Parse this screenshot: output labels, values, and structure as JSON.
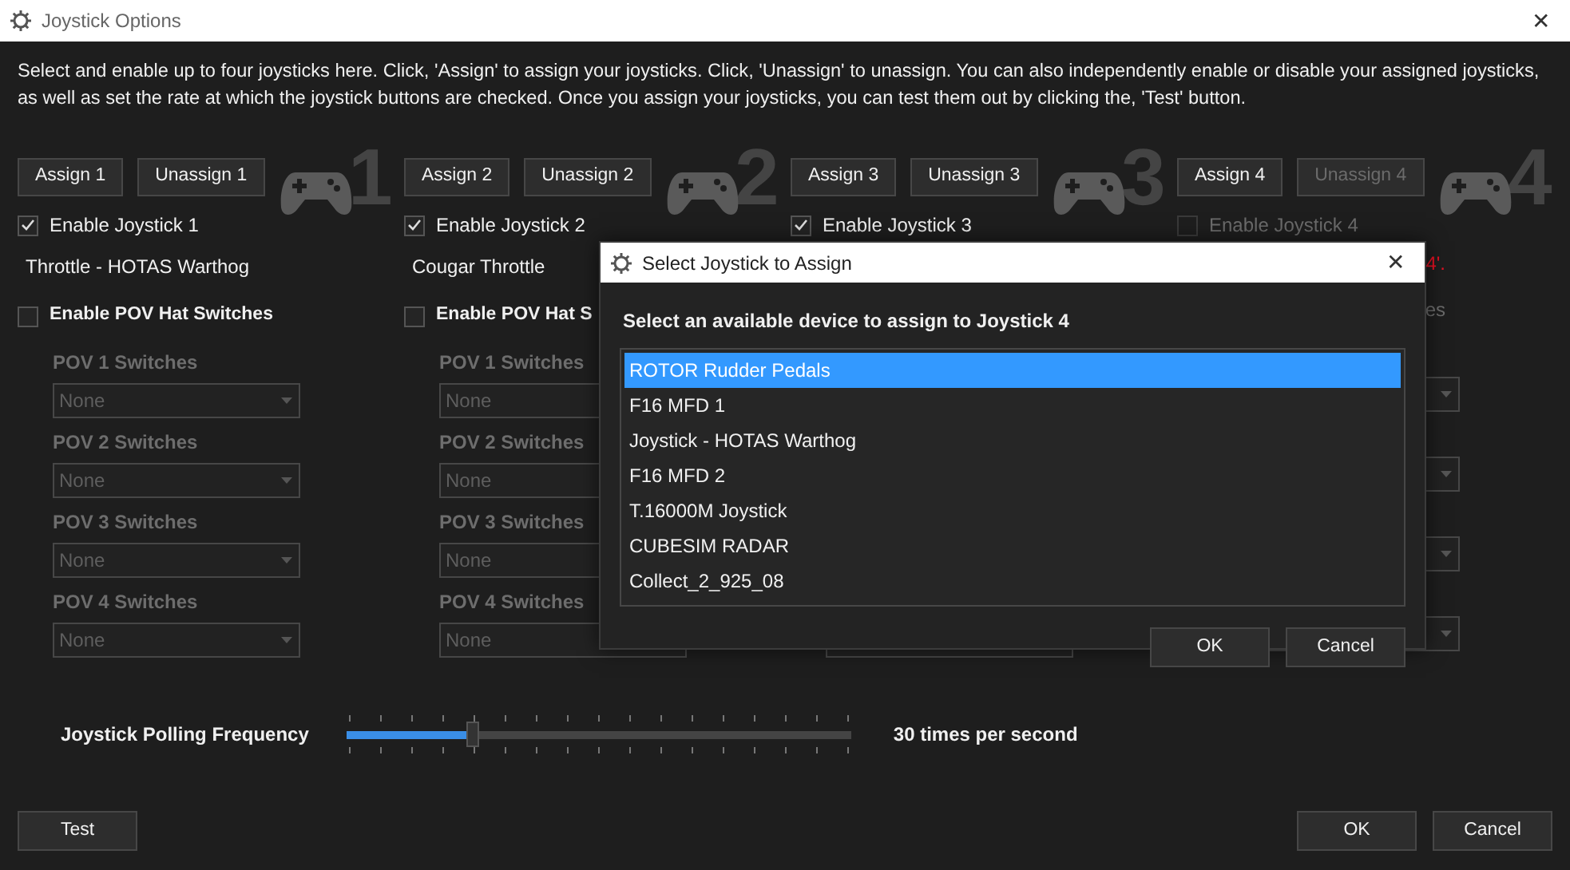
{
  "window": {
    "title": "Joystick Options",
    "close": "✕"
  },
  "description": "Select and enable up to four joysticks here.  Click, 'Assign' to assign your joysticks.  Click, 'Unassign' to unassign.  You can also independently enable or disable your assigned joysticks, as well as set the rate at which the joystick buttons are checked.  Once you assign your joysticks, you can test them out by clicking the, 'Test' button.",
  "joysticks": [
    {
      "number": "1",
      "assign": {
        "label": "Assign 1",
        "disabled": false
      },
      "unassign": {
        "label": "Unassign 1",
        "disabled": false
      },
      "enable": {
        "label": "Enable Joystick 1",
        "checked": true,
        "disabled": false
      },
      "device": "Throttle - HOTAS Warthog",
      "pov_hat": {
        "label": "Enable POV Hat Switches",
        "checked": false
      },
      "pov": [
        {
          "label": "POV 1 Switches",
          "value": "None",
          "disabled": true
        },
        {
          "label": "POV 2 Switches",
          "value": "None",
          "disabled": true
        },
        {
          "label": "POV 3 Switches",
          "value": "None",
          "disabled": true
        },
        {
          "label": "POV 4 Switches",
          "value": "None",
          "disabled": true
        }
      ]
    },
    {
      "number": "2",
      "assign": {
        "label": "Assign 2",
        "disabled": false
      },
      "unassign": {
        "label": "Unassign 2",
        "disabled": false
      },
      "enable": {
        "label": "Enable Joystick 2",
        "checked": true,
        "disabled": false
      },
      "device": "Cougar Throttle",
      "pov_hat": {
        "label": "Enable POV Hat S",
        "checked": false
      },
      "pov": [
        {
          "label": "POV 1 Switches",
          "value": "None",
          "disabled": true
        },
        {
          "label": "POV 2 Switches",
          "value": "None",
          "disabled": true
        },
        {
          "label": "POV 3 Switches",
          "value": "None",
          "disabled": true
        },
        {
          "label": "POV 4 Switches",
          "value": "None",
          "disabled": true
        }
      ]
    },
    {
      "number": "3",
      "assign": {
        "label": "Assign 3",
        "disabled": false
      },
      "unassign": {
        "label": "Unassign 3",
        "disabled": false
      },
      "enable": {
        "label": "Enable Joystick 3",
        "checked": true,
        "disabled": false
      },
      "pov": [
        {
          "disabled": true
        }
      ]
    },
    {
      "number": "4",
      "assign": {
        "label": "Assign 4",
        "disabled": false
      },
      "unassign": {
        "label": "Unassign 4",
        "disabled": true
      },
      "enable": {
        "label": "Enable Joystick 4",
        "checked": false,
        "disabled": true
      },
      "message": "4'.",
      "pov_hat": {
        "label": "es"
      },
      "pov": [
        {
          "disabled": true
        },
        {
          "disabled": true
        },
        {
          "disabled": true
        },
        {
          "disabled": true
        }
      ]
    }
  ],
  "polling": {
    "label": "Joystick Polling Frequency",
    "level": 0.25,
    "reading": "30 times per second"
  },
  "buttons": {
    "test": "Test",
    "ok": "OK",
    "cancel": "Cancel"
  },
  "dialog": {
    "title": "Select Joystick to Assign",
    "close": "✕",
    "prompt": "Select an available device to assign to Joystick 4",
    "devices": [
      {
        "label": "ROTOR Rudder Pedals",
        "selected": true
      },
      {
        "label": "F16 MFD 1",
        "selected": false
      },
      {
        "label": "Joystick - HOTAS Warthog",
        "selected": false
      },
      {
        "label": "F16 MFD 2",
        "selected": false
      },
      {
        "label": "T.16000M Joystick",
        "selected": false
      },
      {
        "label": "CUBESIM RADAR",
        "selected": false
      },
      {
        "label": "Collect_2_925_08",
        "selected": false
      }
    ],
    "ok": "OK",
    "cancel": "Cancel"
  }
}
